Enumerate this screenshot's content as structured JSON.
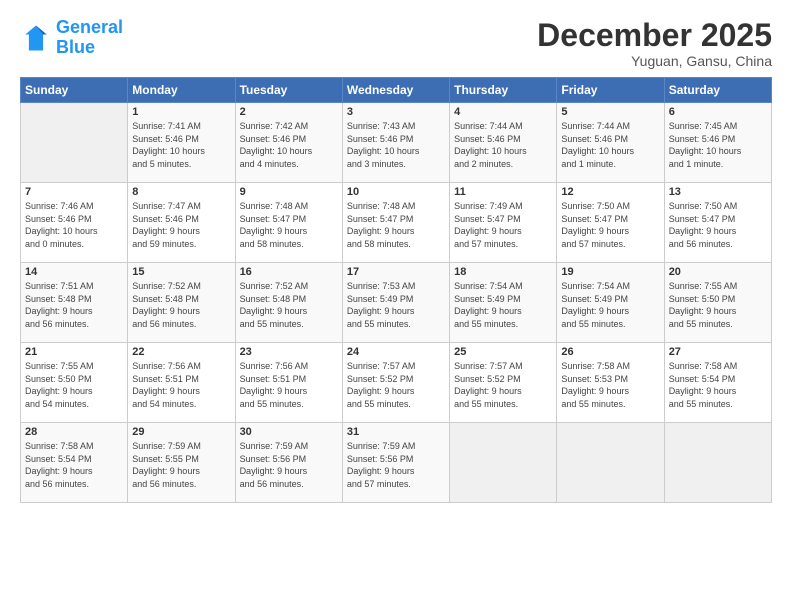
{
  "header": {
    "logo_line1": "General",
    "logo_line2": "Blue",
    "month": "December 2025",
    "location": "Yuguan, Gansu, China"
  },
  "weekdays": [
    "Sunday",
    "Monday",
    "Tuesday",
    "Wednesday",
    "Thursday",
    "Friday",
    "Saturday"
  ],
  "weeks": [
    [
      {
        "day": "",
        "info": ""
      },
      {
        "day": "1",
        "info": "Sunrise: 7:41 AM\nSunset: 5:46 PM\nDaylight: 10 hours\nand 5 minutes."
      },
      {
        "day": "2",
        "info": "Sunrise: 7:42 AM\nSunset: 5:46 PM\nDaylight: 10 hours\nand 4 minutes."
      },
      {
        "day": "3",
        "info": "Sunrise: 7:43 AM\nSunset: 5:46 PM\nDaylight: 10 hours\nand 3 minutes."
      },
      {
        "day": "4",
        "info": "Sunrise: 7:44 AM\nSunset: 5:46 PM\nDaylight: 10 hours\nand 2 minutes."
      },
      {
        "day": "5",
        "info": "Sunrise: 7:44 AM\nSunset: 5:46 PM\nDaylight: 10 hours\nand 1 minute."
      },
      {
        "day": "6",
        "info": "Sunrise: 7:45 AM\nSunset: 5:46 PM\nDaylight: 10 hours\nand 1 minute."
      }
    ],
    [
      {
        "day": "7",
        "info": "Sunrise: 7:46 AM\nSunset: 5:46 PM\nDaylight: 10 hours\nand 0 minutes."
      },
      {
        "day": "8",
        "info": "Sunrise: 7:47 AM\nSunset: 5:46 PM\nDaylight: 9 hours\nand 59 minutes."
      },
      {
        "day": "9",
        "info": "Sunrise: 7:48 AM\nSunset: 5:47 PM\nDaylight: 9 hours\nand 58 minutes."
      },
      {
        "day": "10",
        "info": "Sunrise: 7:48 AM\nSunset: 5:47 PM\nDaylight: 9 hours\nand 58 minutes."
      },
      {
        "day": "11",
        "info": "Sunrise: 7:49 AM\nSunset: 5:47 PM\nDaylight: 9 hours\nand 57 minutes."
      },
      {
        "day": "12",
        "info": "Sunrise: 7:50 AM\nSunset: 5:47 PM\nDaylight: 9 hours\nand 57 minutes."
      },
      {
        "day": "13",
        "info": "Sunrise: 7:50 AM\nSunset: 5:47 PM\nDaylight: 9 hours\nand 56 minutes."
      }
    ],
    [
      {
        "day": "14",
        "info": "Sunrise: 7:51 AM\nSunset: 5:48 PM\nDaylight: 9 hours\nand 56 minutes."
      },
      {
        "day": "15",
        "info": "Sunrise: 7:52 AM\nSunset: 5:48 PM\nDaylight: 9 hours\nand 56 minutes."
      },
      {
        "day": "16",
        "info": "Sunrise: 7:52 AM\nSunset: 5:48 PM\nDaylight: 9 hours\nand 55 minutes."
      },
      {
        "day": "17",
        "info": "Sunrise: 7:53 AM\nSunset: 5:49 PM\nDaylight: 9 hours\nand 55 minutes."
      },
      {
        "day": "18",
        "info": "Sunrise: 7:54 AM\nSunset: 5:49 PM\nDaylight: 9 hours\nand 55 minutes."
      },
      {
        "day": "19",
        "info": "Sunrise: 7:54 AM\nSunset: 5:49 PM\nDaylight: 9 hours\nand 55 minutes."
      },
      {
        "day": "20",
        "info": "Sunrise: 7:55 AM\nSunset: 5:50 PM\nDaylight: 9 hours\nand 55 minutes."
      }
    ],
    [
      {
        "day": "21",
        "info": "Sunrise: 7:55 AM\nSunset: 5:50 PM\nDaylight: 9 hours\nand 54 minutes."
      },
      {
        "day": "22",
        "info": "Sunrise: 7:56 AM\nSunset: 5:51 PM\nDaylight: 9 hours\nand 54 minutes."
      },
      {
        "day": "23",
        "info": "Sunrise: 7:56 AM\nSunset: 5:51 PM\nDaylight: 9 hours\nand 55 minutes."
      },
      {
        "day": "24",
        "info": "Sunrise: 7:57 AM\nSunset: 5:52 PM\nDaylight: 9 hours\nand 55 minutes."
      },
      {
        "day": "25",
        "info": "Sunrise: 7:57 AM\nSunset: 5:52 PM\nDaylight: 9 hours\nand 55 minutes."
      },
      {
        "day": "26",
        "info": "Sunrise: 7:58 AM\nSunset: 5:53 PM\nDaylight: 9 hours\nand 55 minutes."
      },
      {
        "day": "27",
        "info": "Sunrise: 7:58 AM\nSunset: 5:54 PM\nDaylight: 9 hours\nand 55 minutes."
      }
    ],
    [
      {
        "day": "28",
        "info": "Sunrise: 7:58 AM\nSunset: 5:54 PM\nDaylight: 9 hours\nand 56 minutes."
      },
      {
        "day": "29",
        "info": "Sunrise: 7:59 AM\nSunset: 5:55 PM\nDaylight: 9 hours\nand 56 minutes."
      },
      {
        "day": "30",
        "info": "Sunrise: 7:59 AM\nSunset: 5:56 PM\nDaylight: 9 hours\nand 56 minutes."
      },
      {
        "day": "31",
        "info": "Sunrise: 7:59 AM\nSunset: 5:56 PM\nDaylight: 9 hours\nand 57 minutes."
      },
      {
        "day": "",
        "info": ""
      },
      {
        "day": "",
        "info": ""
      },
      {
        "day": "",
        "info": ""
      }
    ]
  ]
}
